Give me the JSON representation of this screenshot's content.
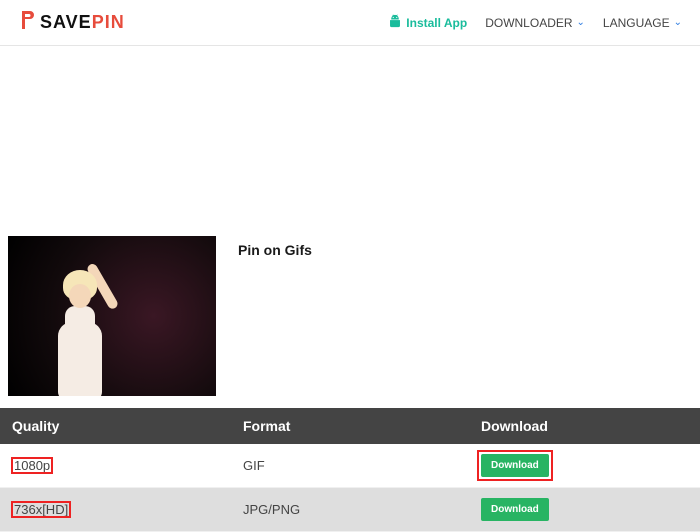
{
  "brand": {
    "save": "SAVE",
    "pin": "PIN"
  },
  "nav": {
    "install": "Install App",
    "downloader": "DOWNLOADER",
    "language": "LANGUAGE"
  },
  "pin": {
    "title": "Pin on Gifs"
  },
  "table": {
    "headers": {
      "quality": "Quality",
      "format": "Format",
      "download": "Download"
    },
    "rows": [
      {
        "quality": "1080p",
        "format": "GIF",
        "button": "Download",
        "hl_quality": true,
        "hl_button": true
      },
      {
        "quality": "736x[HD]",
        "format": "JPG/PNG",
        "button": "Download",
        "hl_quality": true,
        "hl_button": false
      }
    ]
  }
}
